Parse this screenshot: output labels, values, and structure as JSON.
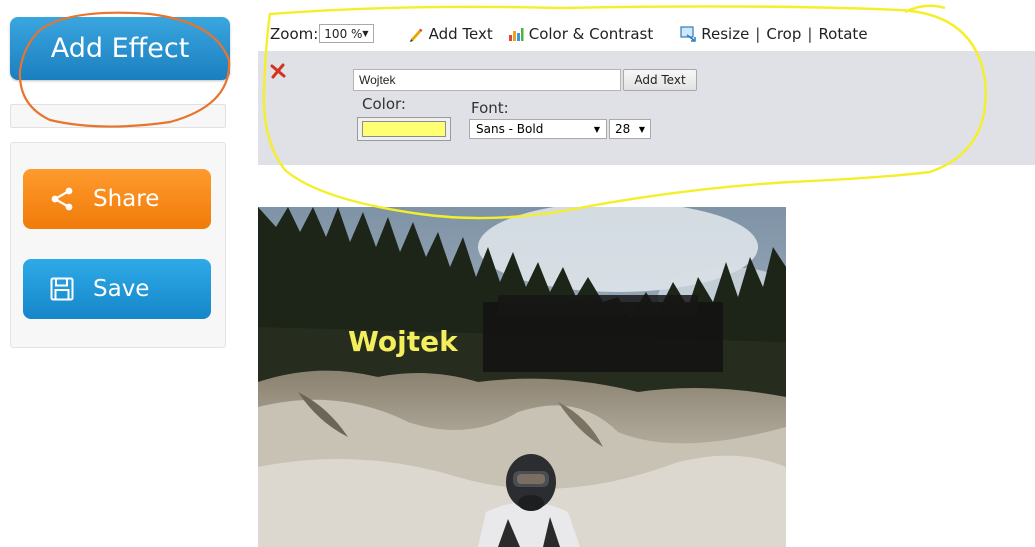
{
  "sidebar": {
    "add_effect_label": "Add Effect",
    "share_label": "Share",
    "save_label": "Save"
  },
  "toolbar": {
    "zoom_label": "Zoom:",
    "zoom_value": "100 %",
    "add_text": "Add Text",
    "color_contrast": "Color & Contrast",
    "resize": "Resize",
    "separator": "|",
    "crop": "Crop",
    "rotate": "Rotate"
  },
  "text_panel": {
    "input_value": "Wojtek",
    "add_text_button": "Add Text",
    "color_label": "Color:",
    "color_value": "#ffff73",
    "font_label": "Font:",
    "font_value": "Sans - Bold",
    "size_value": "28"
  },
  "photo": {
    "overlay_text": "Wojtek",
    "overlay_color": "#f2ee5c"
  },
  "colors": {
    "accent_blue": "#1b7fbf",
    "accent_orange": "#f07c09",
    "annotation_yellow": "#f4ef2a",
    "annotation_orange": "#e8742e"
  },
  "icons": {
    "share": "share-icon",
    "save": "floppy-disk-icon",
    "add_text": "pencil-icon",
    "color_contrast": "bars-icon",
    "resize": "resize-icon",
    "close": "close-icon"
  }
}
